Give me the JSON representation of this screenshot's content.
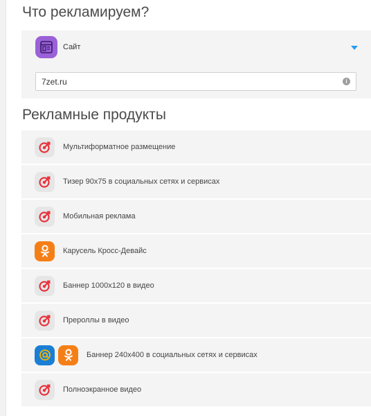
{
  "section_what": {
    "title": "Что рекламируем?",
    "type_label": "Сайт",
    "type_icon": "site-icon",
    "url_value": "7zet.ru"
  },
  "section_products": {
    "title": "Рекламные продукты",
    "items": [
      {
        "label": "Мультиформатное размещение",
        "icons": [
          "target-icon"
        ]
      },
      {
        "label": "Тизер 90x75 в социальных сетях и сервисах",
        "icons": [
          "target-icon"
        ]
      },
      {
        "label": "Мобильная реклама",
        "icons": [
          "target-icon"
        ]
      },
      {
        "label": "Карусель Кросс-Девайс",
        "icons": [
          "odnoklassniki-icon"
        ]
      },
      {
        "label": "Баннер 1000x120 в видео",
        "icons": [
          "target-icon"
        ]
      },
      {
        "label": "Прероллы в видео",
        "icons": [
          "target-icon"
        ]
      },
      {
        "label": "Баннер 240x400 в социальных сетях и сервисах",
        "icons": [
          "mail-at-icon",
          "odnoklassniki-icon"
        ]
      },
      {
        "label": "Полноэкранное видео",
        "icons": [
          "target-icon"
        ]
      }
    ]
  },
  "colors": {
    "accent_blue": "#2a9bf0",
    "site_icon_bg": "#9a61d8",
    "ok_orange": "#f57f17",
    "mail_blue": "#1a7fd4",
    "target_red": "#e8323c",
    "card_bg": "#f4f4f4"
  }
}
